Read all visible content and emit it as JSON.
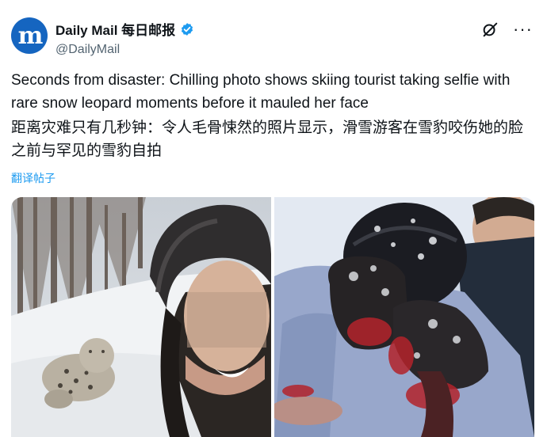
{
  "account": {
    "avatar_letter": "m",
    "display_name": "Daily Mail 每日邮报",
    "handle": "@DailyMail",
    "verified": true
  },
  "actions": {
    "grok_icon": "grok-icon",
    "more": "···"
  },
  "tweet": {
    "text_en": "Seconds from disaster: Chilling photo shows skiing tourist taking selfie with rare snow leopard moments before it mauled her face",
    "text_zh": "距离灾难只有几秒钟：令人毛骨悚然的照片显示，滑雪游客在雪豹咬伤她的脸之前与罕见的雪豹自拍",
    "translate_link": "翻译帖子"
  },
  "colors": {
    "accent": "#1d9bf0",
    "brand": "#1565c0",
    "text": "#0f1419",
    "muted": "#536471"
  }
}
